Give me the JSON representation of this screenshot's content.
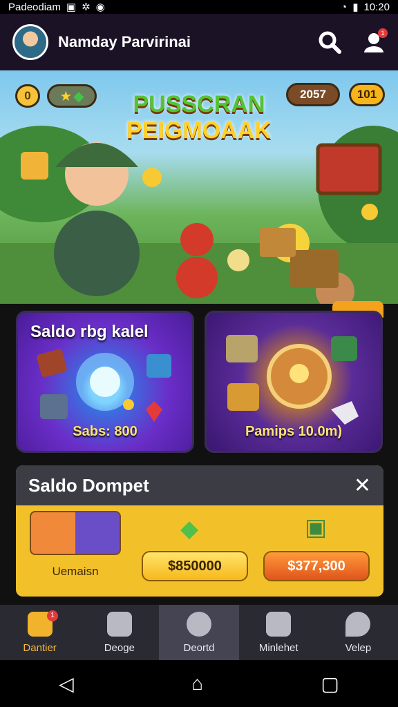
{
  "status": {
    "left_text": "Padeodiam",
    "time": "10:20"
  },
  "appbar": {
    "title": "Namday Parvirinai",
    "notif_count": "1"
  },
  "hero": {
    "title_line1": "PUSSCRAN",
    "title_line2": "PEIGMOAAK",
    "counter_a": "2057",
    "counter_b": "101",
    "coin_label": "0"
  },
  "cards": [
    {
      "title": "Saldo rbg kalel",
      "value": "Sabs: 800"
    },
    {
      "title": "",
      "value": "Pamips 10.0m)"
    }
  ],
  "wallet": {
    "title": "Saldo Dompet",
    "close_label": "✕",
    "thumb_label": "Uemaisn",
    "button_a": "$850000",
    "button_b": "$377,300"
  },
  "nav": [
    {
      "label": "Dantier",
      "icon": "home-icon"
    },
    {
      "label": "Deoge",
      "icon": "document-icon"
    },
    {
      "label": "Deortd",
      "icon": "phone-icon"
    },
    {
      "label": "Minlehet",
      "icon": "robot-icon"
    },
    {
      "label": "Velep",
      "icon": "pin-icon"
    }
  ],
  "nav_badge": "1"
}
